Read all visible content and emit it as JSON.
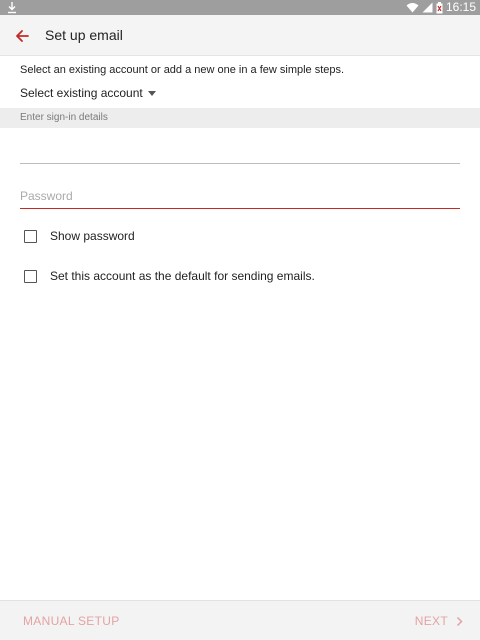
{
  "status_bar": {
    "time": "16:15",
    "icons": [
      "download-icon",
      "wifi-icon",
      "signal-icon",
      "battery-icon"
    ]
  },
  "app_bar": {
    "title": "Set up email",
    "back_icon": "back-arrow-icon"
  },
  "intro_text": "Select an existing account or add a new one in a few simple steps.",
  "account_select": {
    "label": "Select existing account"
  },
  "sign_in": {
    "header": "Enter sign-in details",
    "email_value": "",
    "email_placeholder": "",
    "password_placeholder": "Password"
  },
  "options": {
    "show_password": "Show password",
    "default_account": "Set this account as the default for sending emails."
  },
  "bottom_bar": {
    "manual_setup": "MANUAL SETUP",
    "next": "NEXT"
  },
  "colors": {
    "accent": "#c62828",
    "disabled_accent": "#e3a3a3",
    "status_bar": "#9e9e9e"
  }
}
